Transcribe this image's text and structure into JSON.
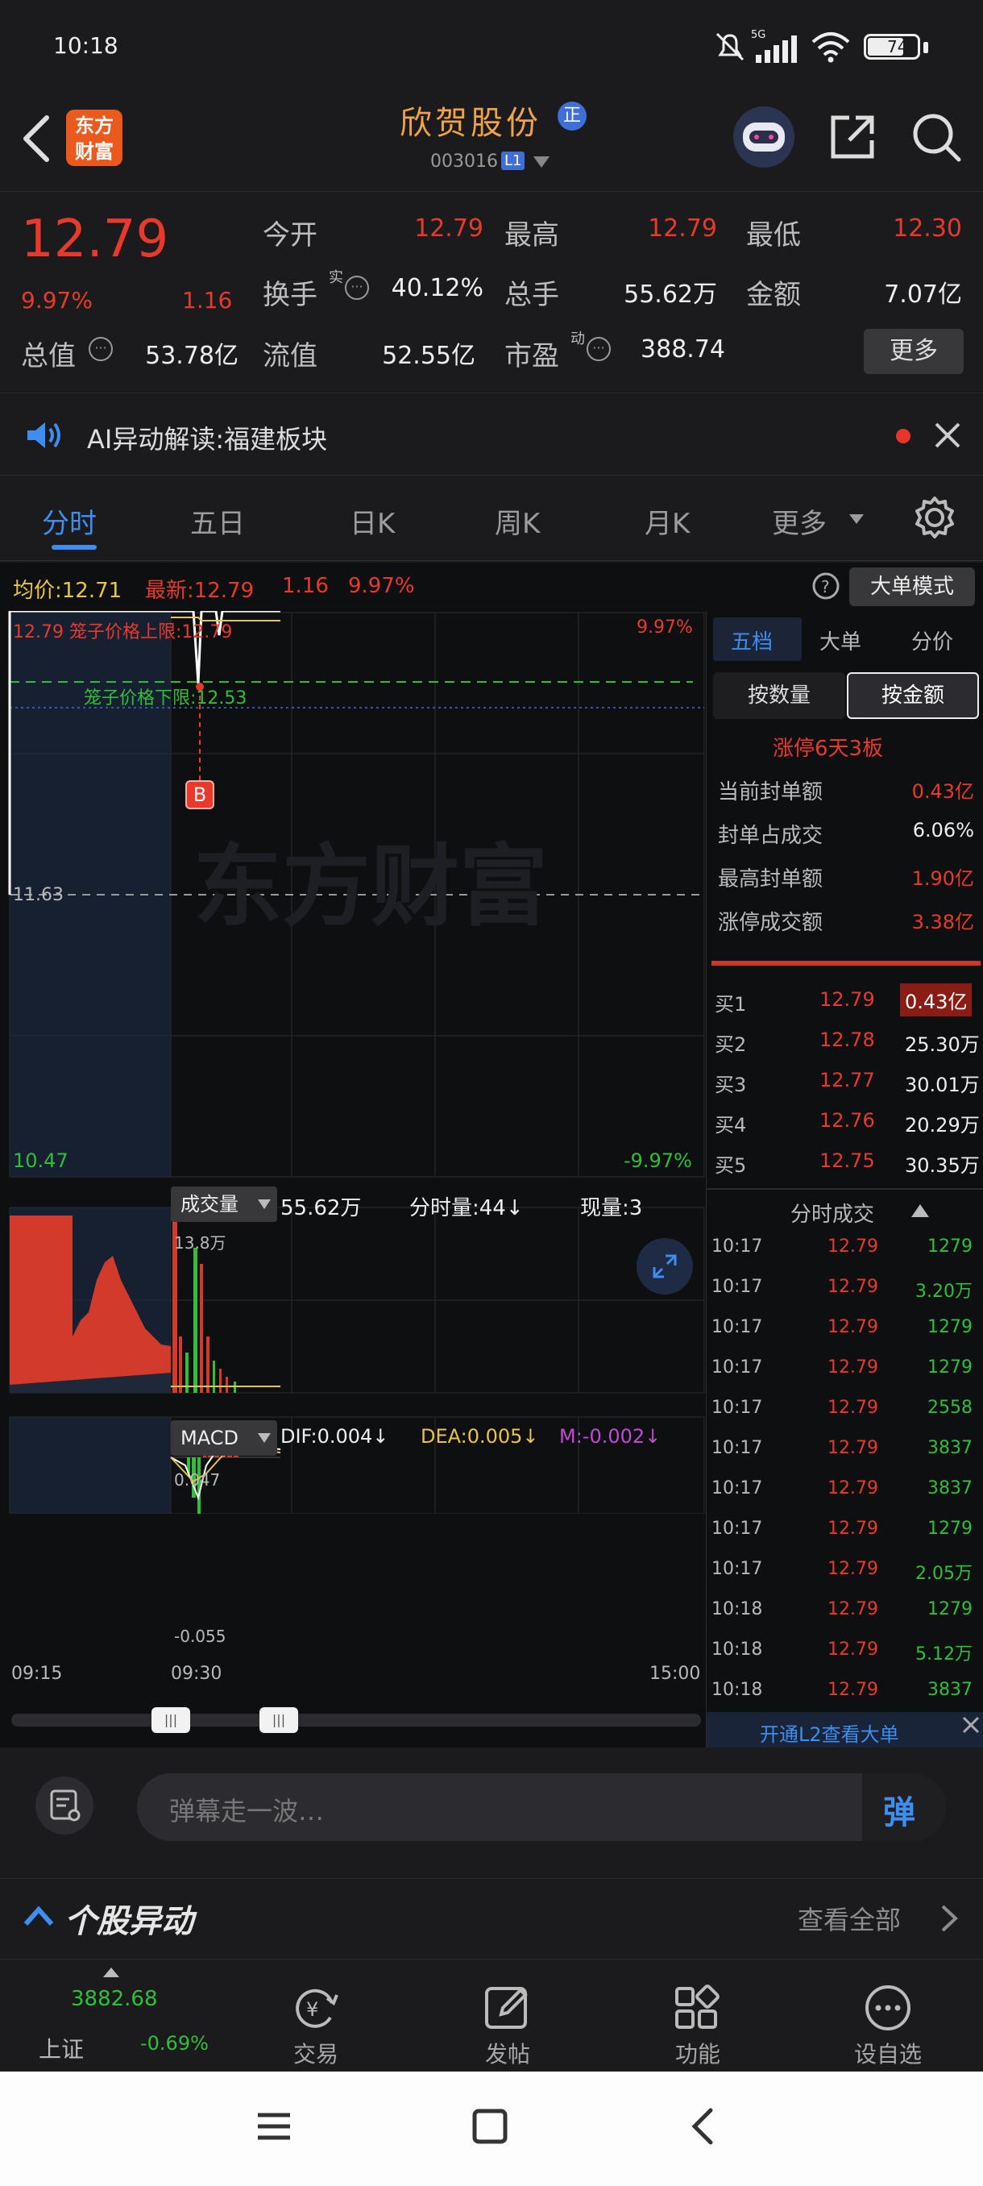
{
  "status": {
    "time": "10:18",
    "battery": "74",
    "signal": "5G"
  },
  "header": {
    "logo_line1": "东方",
    "logo_line2": "财富",
    "stock_name": "欣贺股份",
    "badge": "正",
    "code": "003016",
    "level_badge": "L1"
  },
  "quote": {
    "price": "12.79",
    "pct": "9.97%",
    "change": "1.16",
    "labels": {
      "open": "今开",
      "high": "最高",
      "low": "最低",
      "turnover": "换手",
      "turnover_sup": "实",
      "volume": "总手",
      "amount": "金额",
      "mktcap": "总值",
      "float": "流值",
      "pe": "市盈",
      "pe_sup": "动"
    },
    "open": "12.79",
    "high": "12.79",
    "low": "12.30",
    "turnover": "40.12%",
    "volume": "55.62万",
    "amount": "7.07亿",
    "mktcap": "53.78亿",
    "float": "52.55亿",
    "pe": "388.74",
    "more_button": "更多"
  },
  "ai": {
    "text": "AI异动解读:福建板块"
  },
  "tabs": [
    "分时",
    "五日",
    "日K",
    "周K",
    "月K",
    "更多"
  ],
  "chart_header": {
    "avg_label": "均价:12.71",
    "latest_label": "最新:12.79",
    "change": "1.16",
    "pct": "9.97%",
    "mode_button": "大单模式"
  },
  "chart_labels": {
    "upper_note": "12.79 笼子价格上限:12.79",
    "upper_pct": "9.97%",
    "lower_note": "笼子价格下限:12.53",
    "mid": "11.63",
    "low": "10.47",
    "low_pct": "-9.97%",
    "marker": "B",
    "watermark": "东方财富"
  },
  "volume_panel": {
    "selector": "成交量",
    "total": "55.62万",
    "minute_label": "分时量:44↓",
    "now_label": "现量:3",
    "axis_max": "13.8万"
  },
  "macd_panel": {
    "selector": "MACD",
    "dif": "DIF:0.004↓",
    "dea": "DEA:0.005↓",
    "m": "M:-0.002↓",
    "axis_top": "0.047",
    "axis_bottom": "-0.055"
  },
  "time_axis": [
    "09:15",
    "09:30",
    "15:00"
  ],
  "right_panel": {
    "tabs": [
      "五档",
      "大单",
      "分价"
    ],
    "toggle": [
      "按数量",
      "按金额"
    ],
    "limit_title": "涨停6天3板",
    "limit_rows": [
      {
        "label": "当前封单额",
        "value": "0.43亿"
      },
      {
        "label": "封单占成交",
        "value": "6.06%"
      },
      {
        "label": "最高封单额",
        "value": "1.90亿"
      },
      {
        "label": "涨停成交额",
        "value": "3.38亿"
      }
    ],
    "bids": [
      {
        "label": "买1",
        "price": "12.79",
        "amount": "0.43亿"
      },
      {
        "label": "买2",
        "price": "12.78",
        "amount": "25.30万"
      },
      {
        "label": "买3",
        "price": "12.77",
        "amount": "30.01万"
      },
      {
        "label": "买4",
        "price": "12.76",
        "amount": "20.29万"
      },
      {
        "label": "买5",
        "price": "12.75",
        "amount": "30.35万"
      }
    ],
    "ticks_title": "分时成交",
    "ticks": [
      {
        "time": "10:17",
        "price": "12.79",
        "amount": "1279"
      },
      {
        "time": "10:17",
        "price": "12.79",
        "amount": "3.20万"
      },
      {
        "time": "10:17",
        "price": "12.79",
        "amount": "1279"
      },
      {
        "time": "10:17",
        "price": "12.79",
        "amount": "1279"
      },
      {
        "time": "10:17",
        "price": "12.79",
        "amount": "2558"
      },
      {
        "time": "10:17",
        "price": "12.79",
        "amount": "3837"
      },
      {
        "time": "10:17",
        "price": "12.79",
        "amount": "3837"
      },
      {
        "time": "10:17",
        "price": "12.79",
        "amount": "1279"
      },
      {
        "time": "10:17",
        "price": "12.79",
        "amount": "2.05万"
      },
      {
        "time": "10:18",
        "price": "12.79",
        "amount": "1279"
      },
      {
        "time": "10:18",
        "price": "12.79",
        "amount": "5.12万"
      },
      {
        "time": "10:18",
        "price": "12.79",
        "amount": "3837"
      }
    ],
    "l2_promo": "开通L2查看大单"
  },
  "danmu": {
    "placeholder": "弹幕走一波…",
    "send_icon_text": "弹"
  },
  "anomaly": {
    "title": "个股异动",
    "view_all": "查看全部"
  },
  "bottom_nav": {
    "index_value": "3882.68",
    "index_name": "上证",
    "index_pct": "-0.69%",
    "items": [
      "交易",
      "发帖",
      "功能",
      "设自选"
    ]
  },
  "colors": {
    "up": "#e83a2c",
    "down": "#2fbf3a",
    "accent": "#3d8ef0",
    "price_line": "#ffffff",
    "avg_line": "#e8c44a"
  }
}
